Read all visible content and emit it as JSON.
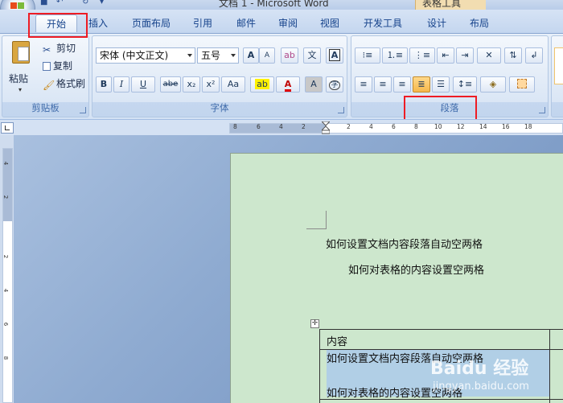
{
  "window": {
    "title": "文档 1 - Microsoft Word",
    "context_tab": "表格工具"
  },
  "tabs": [
    {
      "label": "开始",
      "active": true
    },
    {
      "label": "插入"
    },
    {
      "label": "页面布局"
    },
    {
      "label": "引用"
    },
    {
      "label": "邮件"
    },
    {
      "label": "审阅"
    },
    {
      "label": "视图"
    },
    {
      "label": "开发工具"
    },
    {
      "label": "设计"
    },
    {
      "label": "布局"
    }
  ],
  "clipboard": {
    "paste": "粘贴",
    "cut": "剪切",
    "copy": "复制",
    "format_painter": "格式刷",
    "label": "剪贴板"
  },
  "font": {
    "font_name": "宋体 (中文正文)",
    "font_size": "五号",
    "grow": "A",
    "shrink": "A",
    "bold": "B",
    "italic": "I",
    "underline": "U",
    "strikethrough": "abe",
    "subscript": "x₂",
    "superscript": "x²",
    "change_case": "Aa",
    "font_color": "A",
    "char_shading": "A",
    "char_border": "A",
    "phonetic": "文",
    "enclose": "字",
    "label": "字体"
  },
  "paragraph": {
    "label": "段落"
  },
  "document": {
    "line1": "如何设置文档内容段落自动空两格",
    "line2": "如何对表格的内容设置空两格",
    "table_header": "内容",
    "table_cell_line1": "如何设置文档内容段落自动空两格",
    "table_cell_line2": "如何对表格的内容设置空两格"
  },
  "ruler": {
    "h_ticks": [
      "8",
      "6",
      "4",
      "2",
      "2",
      "4",
      "6",
      "8",
      "10",
      "12",
      "14",
      "16",
      "18"
    ],
    "v_ticks": [
      "4",
      "2",
      "2",
      "4",
      "6",
      "8"
    ]
  },
  "watermark": {
    "brand": "Baidu 经验",
    "url": "jingyan.baidu.com"
  },
  "colors": {
    "accent": "#15428b",
    "highlight_box": "#ee1c24",
    "page": "#cde7cd",
    "selection": "#b1cfe6"
  }
}
